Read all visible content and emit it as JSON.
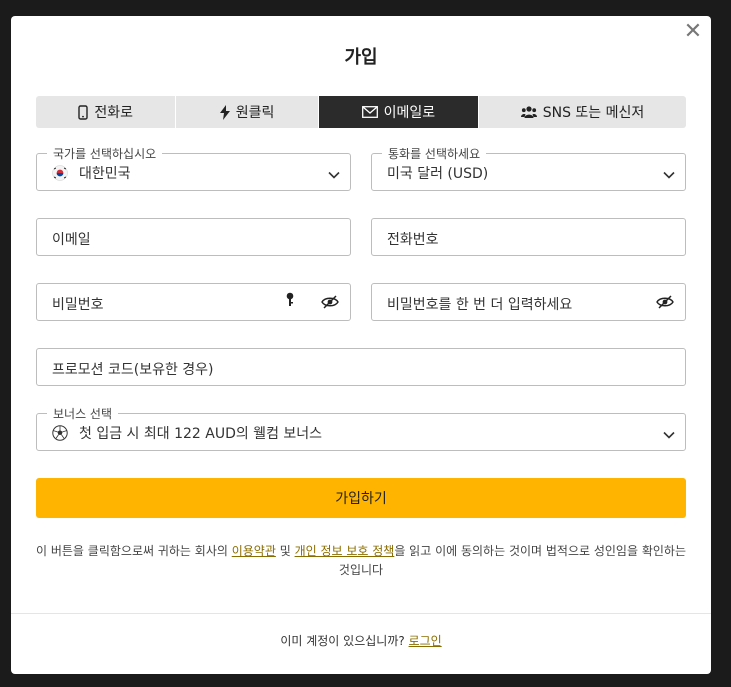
{
  "modal": {
    "title": "가입"
  },
  "tabs": [
    {
      "label": "전화로",
      "icon": "phone-icon",
      "active": false
    },
    {
      "label": "원클릭",
      "icon": "lightning-icon",
      "active": false
    },
    {
      "label": "이메일로",
      "icon": "envelope-icon",
      "active": true
    },
    {
      "label": "SNS 또는 메신저",
      "icon": "users-icon",
      "active": false
    }
  ],
  "form": {
    "country": {
      "label": "국가를 선택하십시오",
      "value": "대한민국",
      "icon": "south-korea-flag-icon"
    },
    "currency": {
      "label": "통화를 선택하세요",
      "value": "미국 달러 (USD)"
    },
    "email": {
      "placeholder": "이메일"
    },
    "phone": {
      "placeholder": "전화번호"
    },
    "password": {
      "placeholder": "비밀번호"
    },
    "password_confirm": {
      "placeholder": "비밀번호를 한 번 더 입력하세요"
    },
    "promo": {
      "placeholder": "프로모션 코드(보유한 경우)"
    },
    "bonus": {
      "label": "보너스 선택",
      "value": "첫 입금 시 최대 122 AUD의 웰컴 보너스",
      "icon": "soccer-ball-icon"
    }
  },
  "submit_label": "가입하기",
  "terms": {
    "prefix": "이 버튼을 클릭함으로써 귀하는 회사의 ",
    "link1": "이용약관",
    "mid": " 및 ",
    "link2": "개인 정보 보호 정책",
    "suffix": "을 읽고 이에 동의하는 것이며 법적으로 성인임을 확인하는 것입니다"
  },
  "footer": {
    "text": "이미 계정이 있으십니까? ",
    "link": "로그인"
  },
  "colors": {
    "accent": "#ffb500",
    "active_tab": "#2b2b2b",
    "link": "#8a6d00"
  }
}
